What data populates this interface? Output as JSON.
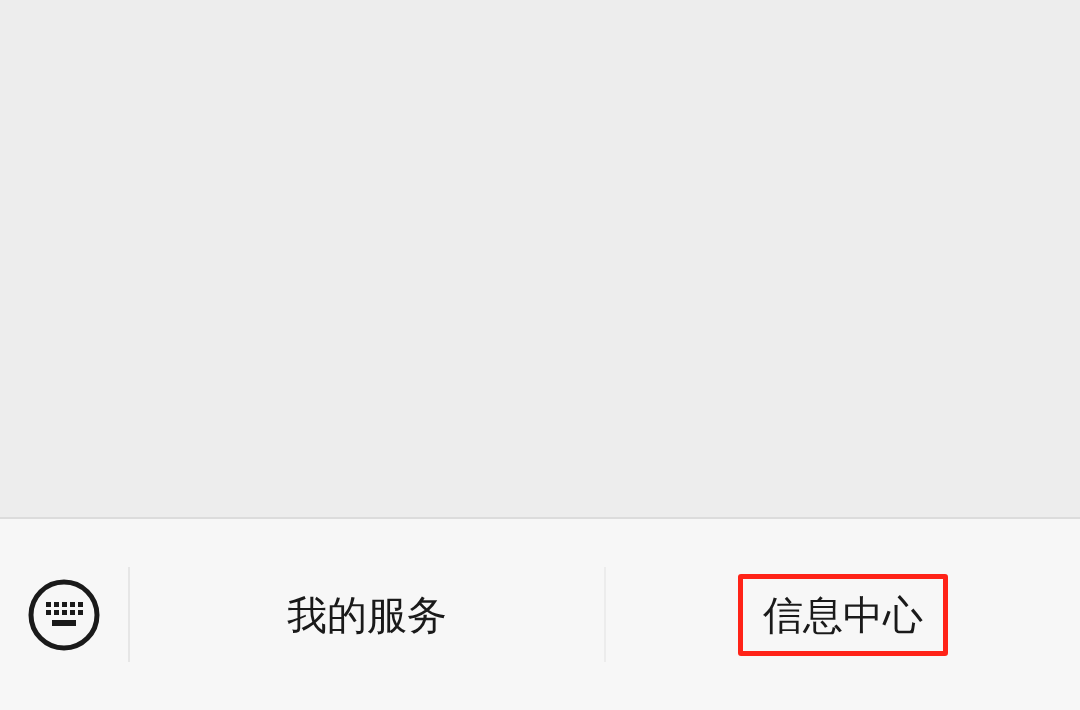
{
  "menu": [
    {
      "label": "我的服务",
      "highlighted": false
    },
    {
      "label": "信息中心",
      "highlighted": true
    }
  ]
}
